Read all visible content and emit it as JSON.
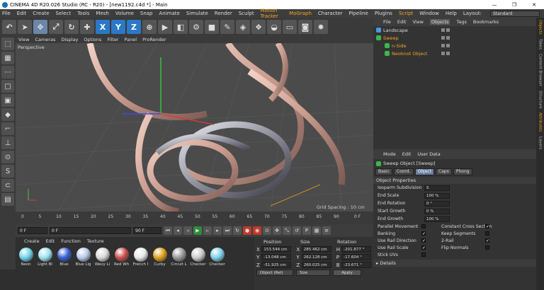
{
  "window": {
    "title": "CINEMA 4D R20.026 Studio (RC - R20) - [new1192.c4d *] - Main",
    "controls": [
      "—",
      "❐",
      "✕"
    ]
  },
  "menu": {
    "items": [
      "File",
      "Edit",
      "Create",
      "Select",
      "Tools",
      "Mesh",
      "Volume",
      "Snap",
      "Animate",
      "Simulate",
      "Render",
      "Sculpt",
      "Motion Tracker",
      "MoGraph",
      "Character",
      "Pipeline",
      "Plugins",
      "Script",
      "Window",
      "Help"
    ],
    "layout_label": "Layout:",
    "layout_value": "Standard"
  },
  "toolbar": {
    "icons": [
      "undo-icon",
      "cursor-icon",
      "move-icon",
      "scale-icon",
      "rotate-icon",
      "add-icon",
      "x-axis-icon",
      "y-axis-icon",
      "z-axis-icon",
      "coordinate-system-icon",
      "render-view-icon",
      "render-picture-icon",
      "render-settings-icon",
      "cube-icon",
      "pen-icon",
      "subdivision-icon",
      "array-icon",
      "deformer-icon",
      "floor-icon",
      "camera-icon",
      "light-icon"
    ],
    "axis_labels": [
      "X",
      "Y",
      "Z"
    ]
  },
  "viewport": {
    "menu": [
      "View",
      "Cameras",
      "Display",
      "Options",
      "Filter",
      "Panel",
      "ProRender"
    ],
    "camera_label": "Perspective",
    "grid_label": "Grid Spacing : 10 cm"
  },
  "timeline": {
    "ticks": [
      "0",
      "5",
      "10",
      "15",
      "20",
      "25",
      "30",
      "35",
      "40",
      "45",
      "50",
      "55",
      "60",
      "65",
      "70",
      "75",
      "80",
      "85",
      "90"
    ],
    "end_label": "0 F"
  },
  "playback": {
    "start": "0 F",
    "current": "0 F",
    "end": "90 F",
    "end2": "90 F"
  },
  "materials": {
    "menu": [
      "Create",
      "Edit",
      "Function",
      "Texture"
    ],
    "items": [
      {
        "name": "Neon",
        "color": "#6fd3e6"
      },
      {
        "name": "Light Bl",
        "color": "#9fe2ee"
      },
      {
        "name": "Blue",
        "color": "#3a5fd0"
      },
      {
        "name": "Blue Lig",
        "color": "#b9c8e8"
      },
      {
        "name": "Wavy Li",
        "color": "#d8d8d8"
      },
      {
        "name": "Red Wh",
        "color": "#c85050"
      },
      {
        "name": "French I",
        "color": "#e8e8e8"
      },
      {
        "name": "Curby",
        "color": "#e0a020"
      },
      {
        "name": "Circuit L",
        "color": "#9a9a9a"
      },
      {
        "name": "Checker",
        "color": "#cccccc"
      },
      {
        "name": "Checker",
        "color": "#7fd0e8"
      }
    ]
  },
  "coordinates": {
    "headers": [
      "Position",
      "Size",
      "Rotation"
    ],
    "rows": [
      {
        "axis": "X",
        "pos": "153.544 cm",
        "size": "285.462 cm",
        "rot_axis": "H",
        "rot": "-201.877 °"
      },
      {
        "axis": "Y",
        "pos": "-13.048 cm",
        "size": "262.128 cm",
        "rot_axis": "P",
        "rot": "-17.604 °"
      },
      {
        "axis": "Z",
        "pos": "-51.925 cm",
        "size": "260.025 cm",
        "rot_axis": "B",
        "rot": "-23.671 °"
      }
    ],
    "mode": "Object (Rel)",
    "size_mode": "Size",
    "apply": "Apply"
  },
  "objects": {
    "menu": [
      "File",
      "Edit",
      "View",
      "Objects",
      "Tags",
      "Bookmarks"
    ],
    "rows": [
      {
        "name": "Landscape",
        "color": "#4a9bd8",
        "indent": 0,
        "text_color": "#dddddd"
      },
      {
        "name": "Sweep",
        "color": "#3ab84a",
        "indent": 0,
        "text_color": "#f5a623"
      },
      {
        "name": "n-Side",
        "color": "#3ab84a",
        "indent": 1,
        "text_color": "#f5a623"
      },
      {
        "name": "Neoknot Object",
        "color": "#3ab84a",
        "indent": 1,
        "text_color": "#f5a623"
      }
    ]
  },
  "attributes": {
    "menu": [
      "Mode",
      "Edit",
      "User Data"
    ],
    "title": "Sweep Object [Sweep]",
    "tabs": [
      "Basic",
      "Coord.",
      "Object",
      "Caps",
      "Phong"
    ],
    "active_tab": "Object",
    "section": "Object Properties",
    "props": [
      {
        "label": "Isoparm Subdivision",
        "value": "5"
      },
      {
        "label": "End Scale",
        "value": "100 %"
      },
      {
        "label": "End Rotation",
        "value": "0 °"
      },
      {
        "label": "Start Growth",
        "value": "0 %"
      },
      {
        "label": "End Growth",
        "value": "100 %"
      }
    ],
    "checks": [
      {
        "left": "Parallel Movement",
        "left_checked": false,
        "right": "Constant Cross Section",
        "right_checked": true
      },
      {
        "left": "Banking",
        "left_checked": true,
        "right": "Keep Segments",
        "right_checked": false
      },
      {
        "left": "Use Rail Direction",
        "left_checked": true,
        "right": "2-Rail",
        "right_checked": true
      },
      {
        "left": "Use Rail Scale",
        "left_checked": true,
        "right": "Flip Normals",
        "right_checked": false
      },
      {
        "left": "Stick UVs",
        "left_checked": false,
        "right": "",
        "right_checked": false
      }
    ],
    "details": "Details"
  },
  "sidetabs": [
    "Objects",
    "Takes",
    "Content Browser",
    "Structure",
    "Attributes",
    "Layers"
  ],
  "colors": {
    "accent": "#f5a623",
    "blue": "#2b78c6",
    "panel": "#333333"
  }
}
